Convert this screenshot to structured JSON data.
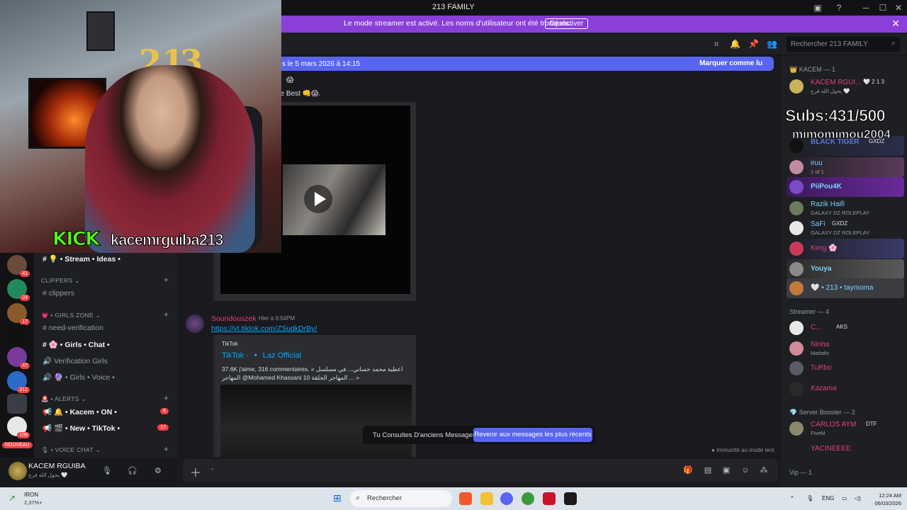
{
  "window": {
    "title": "213 FAMILY"
  },
  "banner": {
    "text": "Le mode streamer est activé. Les noms d'utilisateur ont été tronqués.",
    "button": "Désactiver"
  },
  "header": {
    "search_placeholder": "Rechercher 213 FAMILY"
  },
  "newbar": {
    "left": "s le 5 mars 2026 à 14:15",
    "right": "Marquer comme lu"
  },
  "chat": {
    "partial_line1": "😱",
    "partial_line2": "he Best 👊😱.",
    "message2": {
      "author": "Soundouszek",
      "timestamp": "Hier à 9:54PM",
      "link": "https://vt.tiktok.com/ZSudkDrBy/",
      "embed_provider": "TikTok",
      "embed_title": "TikTok · 🔹 Laz Official",
      "embed_desc": "37.6K j'aime, 316 commentaires. « اعطية محمد خساني... في مسلسل المهاجر @Mohamed Khassani 10 المهاجر الحلقة ... »"
    },
    "consult_text": "Tu Consultes D'anciens Messages",
    "consult_button": "Revenir aux messages les plus récents",
    "slowmode": "Immunité au mode lent"
  },
  "channels": {
    "stream_ideas": "💡 • Stream • Ideas •",
    "cat_clippers": "CLIPPERS",
    "clippers": "clippers",
    "cat_girls": "💗 • GIRLS ZONE",
    "need_verification": "need-verification",
    "girls_chat": "🌸 • Girls • Chat •",
    "verification_girls": "Verification Girls",
    "girls_voice": "🔮 • Girls • Voice •",
    "cat_alerts": "🚨 • ALERTS",
    "kacem_on": "🔔 • Kacem • ON •",
    "kacem_on_badge": "6",
    "new_tiktok": "🎬 • New • TikTok •",
    "new_tiktok_badge": "17",
    "cat_voice": "🎙 • VOICE CHAT"
  },
  "rail": {
    "badges": [
      "41",
      "24",
      "17",
      "47",
      "312",
      "109"
    ],
    "nouveau": "NOUVEAU"
  },
  "user": {
    "name": "KACEM RGUIBA",
    "status": "يحول الله فرج 🤍"
  },
  "stream_overlay": {
    "kick": "KICK",
    "handle": "kacemrguiba213",
    "subs": "Subs:431/500",
    "subs_name": "mimomimou2004"
  },
  "members": {
    "group1": "👑 KACEM — 1",
    "m1": {
      "name": "KACEM RGUI...",
      "tag": "🤍 2 1 3",
      "sub": "يحول الله فرج 🤍"
    },
    "m2": {
      "name": "BLACK TIGER",
      "tag": "GXDZ"
    },
    "m3": {
      "name": "iruu",
      "sub": "1 of 1"
    },
    "m4": {
      "name": "PiiPou4K"
    },
    "m5": {
      "name": "Razik Haifi",
      "sub": "GALAXY DZ ROLEPLAY"
    },
    "m6": {
      "name": "SaFi",
      "tag": "GXDZ",
      "sub": "GALAXY DZ ROLEPLAY"
    },
    "m7": {
      "name": "Kιmყ 🌸"
    },
    "m8": {
      "name": "Youya"
    },
    "m9": {
      "name": "🤍 • 213 • taymoma"
    },
    "group2": "Streamer — 4",
    "m10": {
      "name": "C...",
      "tag": "AKS"
    },
    "m11": {
      "name": "Ninha",
      "sub": "Mattafix"
    },
    "m12": {
      "name": "TuRbo"
    },
    "m13": {
      "name": "Kazama"
    },
    "group3": "💎 Server Booster — 2",
    "m14": {
      "name": "CARLOS AYM",
      "tag": "DTF",
      "sub": "FiveM"
    },
    "m15": {
      "name": "YACINEEEE"
    },
    "group4": "Vip — 1"
  },
  "taskbar": {
    "weather_name": "IRON",
    "weather_value": "2,37%+",
    "search": "Rechercher",
    "lang": "ENG",
    "time": "12:24 AM",
    "date": "06/03/2026"
  },
  "colors": {
    "accent": "#5865f2",
    "banner": "#8a3fd9",
    "kick": "#53fc18"
  }
}
